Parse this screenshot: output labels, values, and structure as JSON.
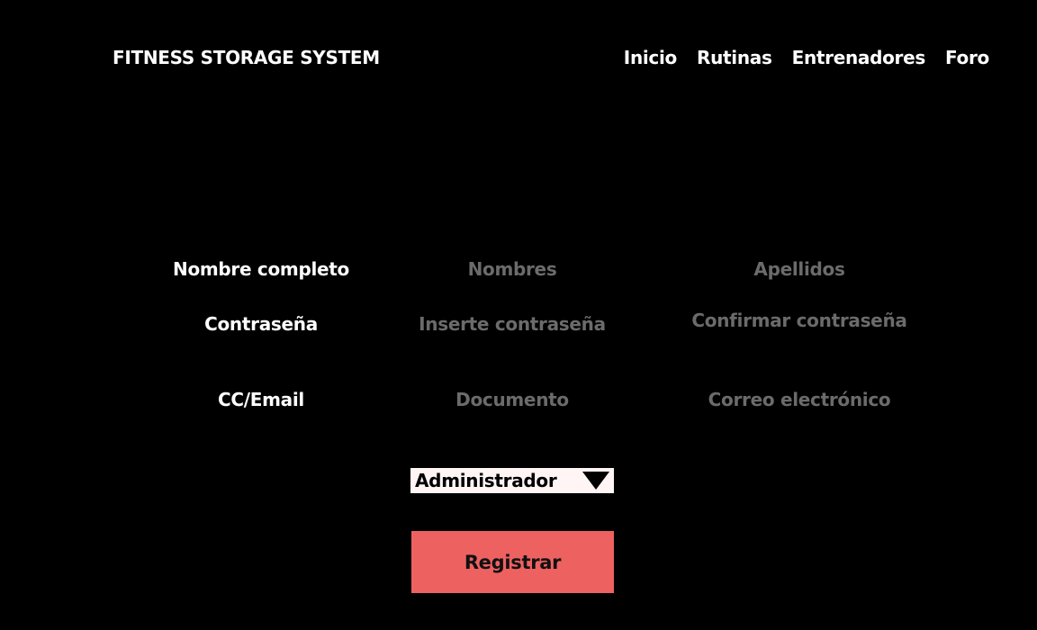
{
  "header": {
    "brand": "FITNESS STORAGE SYSTEM",
    "nav": [
      "Inicio",
      "Rutinas",
      "Entrenadores",
      "Foro"
    ]
  },
  "form": {
    "labels": {
      "nombre": "Nombre completo",
      "contrasena": "Contraseña",
      "cc_email": "CC/Email"
    },
    "placeholders": {
      "nombres": "Nombres",
      "apellidos": "Apellidos",
      "contrasena": "Inserte contraseña",
      "confirmar": "Confirmar contraseña",
      "documento": "Documento",
      "correo": "Correo electrónico"
    },
    "role_select": "Administrador",
    "submit": "Registrar"
  },
  "colors": {
    "background": "#000000",
    "button": "#ee6161",
    "placeholder": "#6b6b6b"
  }
}
